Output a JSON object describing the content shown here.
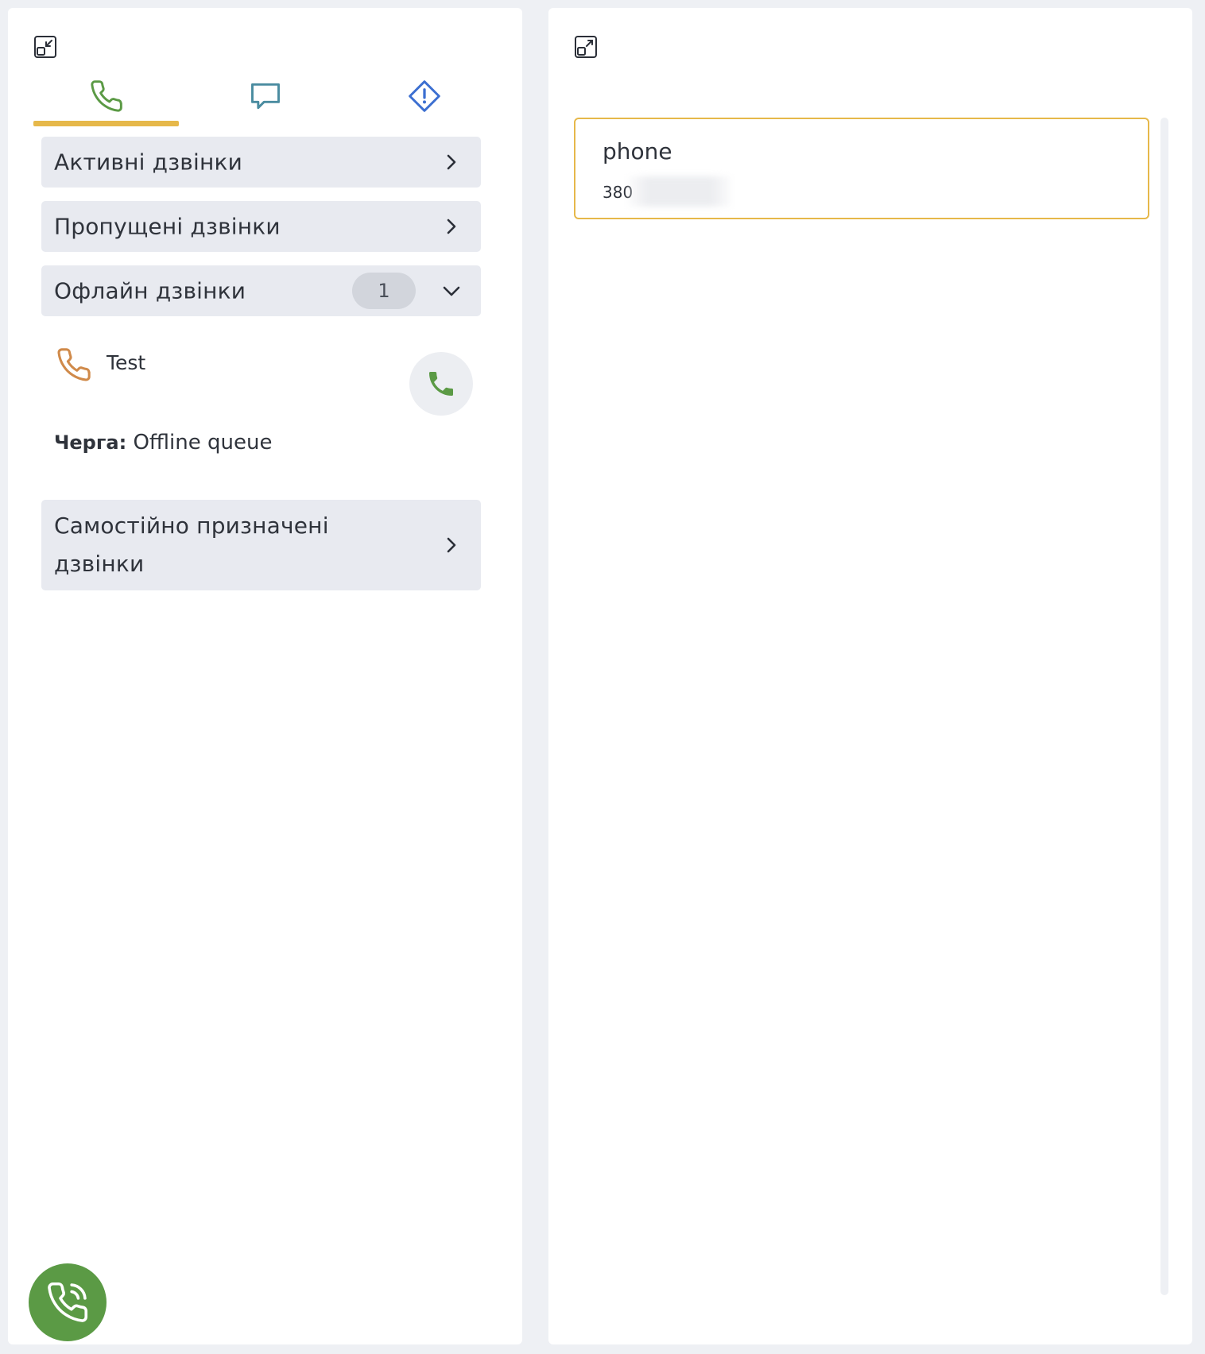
{
  "left_panel": {
    "collapse_icon": "collapse-icon",
    "tabs": [
      {
        "name": "calls",
        "icon": "phone-icon",
        "color": "#5b9a45",
        "active": true
      },
      {
        "name": "chat",
        "icon": "chat-bubble-icon",
        "color": "#4a8ca0",
        "active": false
      },
      {
        "name": "alerts",
        "icon": "alert-diamond-icon",
        "color": "#3c6fd1",
        "active": false
      }
    ],
    "sections": {
      "active_calls": "Активні дзвінки",
      "missed_calls": "Пропущені дзвінки",
      "offline_calls": "Офлайн дзвінки",
      "offline_count": "1",
      "self_assigned": "Самостійно призначені дзвінки"
    },
    "offline_item": {
      "name": "Test",
      "queue_key": "Черга:",
      "queue_value": "Offline queue"
    }
  },
  "right_panel": {
    "expand_icon": "expand-icon",
    "contact": {
      "label": "phone",
      "value": "380"
    }
  },
  "colors": {
    "accent": "#e6b84a",
    "green": "#5b9a45",
    "orange": "#d08a4a"
  }
}
